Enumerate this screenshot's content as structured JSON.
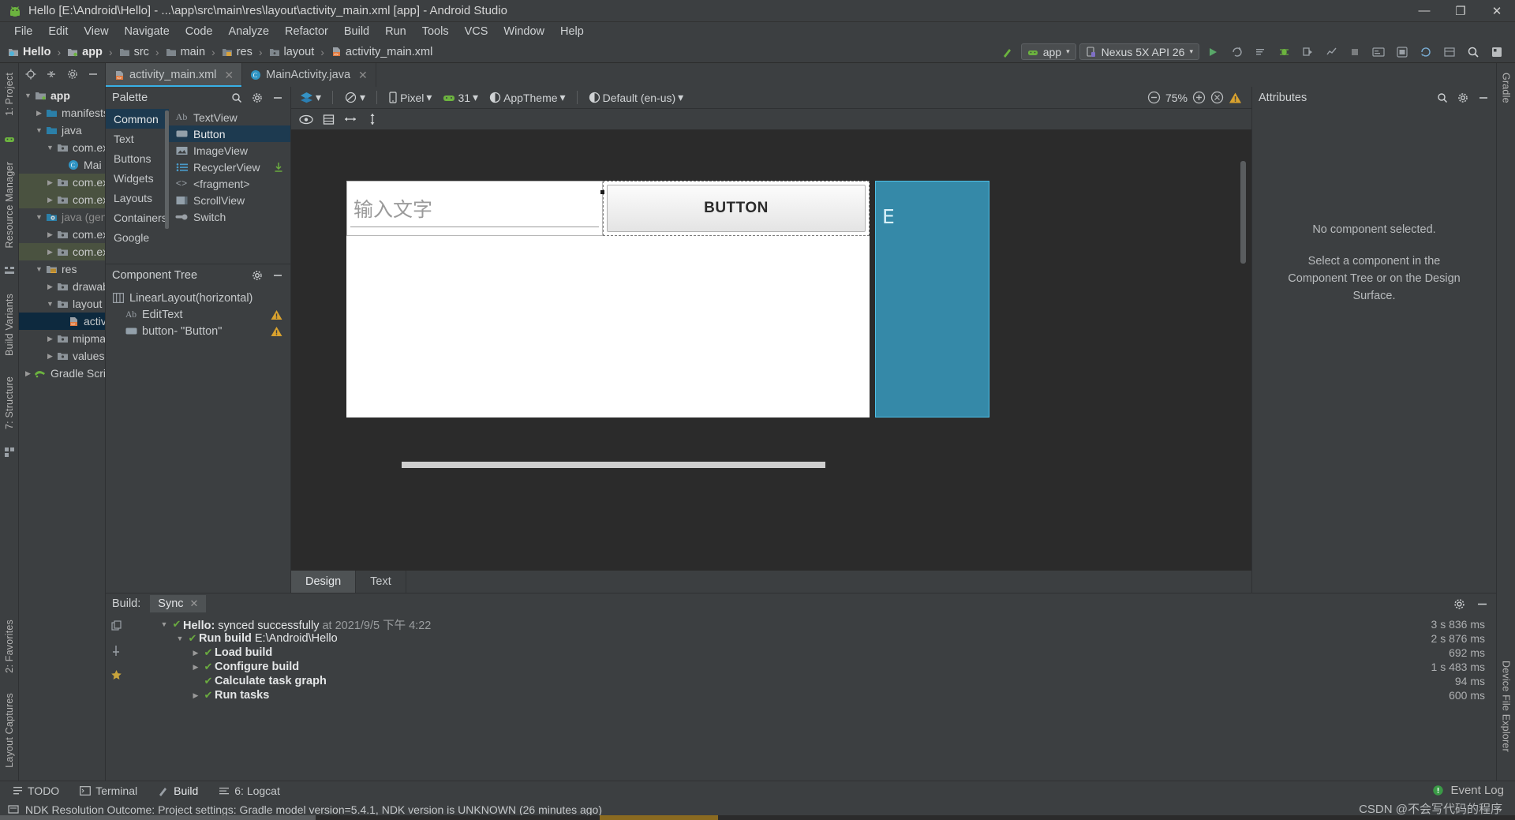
{
  "window": {
    "title": "Hello [E:\\Android\\Hello] - ...\\app\\src\\main\\res\\layout\\activity_main.xml [app] - Android Studio",
    "app_icon": "android-studio-icon",
    "minimize": "—",
    "maximize": "❐",
    "close": "✕"
  },
  "menubar": {
    "items": [
      "File",
      "Edit",
      "View",
      "Navigate",
      "Code",
      "Analyze",
      "Refactor",
      "Build",
      "Run",
      "Tools",
      "VCS",
      "Window",
      "Help"
    ]
  },
  "navbar": {
    "breadcrumbs": [
      {
        "label": "Hello",
        "icon": "module-icon",
        "bold": true
      },
      {
        "label": "app",
        "icon": "app-module-icon",
        "bold": true
      },
      {
        "label": "src",
        "icon": "folder-icon",
        "bold": false
      },
      {
        "label": "main",
        "icon": "folder-icon",
        "bold": false
      },
      {
        "label": "res",
        "icon": "res-folder-icon",
        "bold": false
      },
      {
        "label": "layout",
        "icon": "folder-icon",
        "bold": false
      },
      {
        "label": "activity_main.xml",
        "icon": "xml-layout-icon",
        "bold": false
      }
    ],
    "separator": "›",
    "run_config": {
      "label": "app",
      "icon": "android-head-icon",
      "caret": "▾"
    },
    "device": {
      "label": "Nexus 5X API 26",
      "icon": "device-icon",
      "caret": "▾"
    },
    "icons": [
      "build-hammer-icon",
      "run-icon",
      "apply-changes-icon",
      "apply-code-changes-icon",
      "debug-icon",
      "attach-debugger-icon",
      "profiler-icon",
      "stop-icon",
      "sdk-manager-icon",
      "avd-manager-icon",
      "sync-gradle-icon",
      "layout-inspector-icon",
      "search-icon",
      "settings-icon"
    ]
  },
  "left_rail": {
    "tabs": [
      "1: Project",
      "Resource Manager",
      "Build Variants",
      "7: Structure",
      "2: Favorites",
      "Layout Captures"
    ]
  },
  "right_rail": {
    "tabs": [
      "Gradle",
      "Device File Explorer"
    ]
  },
  "project": {
    "header_icons": [
      "locate-icon",
      "collapse-all-icon",
      "settings-icon",
      "hide-icon"
    ],
    "tree": [
      {
        "depth": 0,
        "twisty": "▼",
        "icon": "app-module-icon",
        "label": "app",
        "bold": true,
        "style": "normal"
      },
      {
        "depth": 1,
        "twisty": "▶",
        "icon": "folder-blue-icon",
        "label": "manifests",
        "bold": false,
        "style": "normal"
      },
      {
        "depth": 1,
        "twisty": "▼",
        "icon": "folder-blue-icon",
        "label": "java",
        "bold": false,
        "style": "normal"
      },
      {
        "depth": 2,
        "twisty": "▼",
        "icon": "package-icon",
        "label": "com.ex",
        "bold": false,
        "style": "normal"
      },
      {
        "depth": 3,
        "twisty": "",
        "icon": "class-icon",
        "label": "Mai",
        "bold": false,
        "style": "normal"
      },
      {
        "depth": 2,
        "twisty": "▶",
        "icon": "package-icon",
        "label": "com.ex",
        "bold": false,
        "style": "green"
      },
      {
        "depth": 2,
        "twisty": "▶",
        "icon": "package-icon",
        "label": "com.ex",
        "bold": false,
        "style": "green"
      },
      {
        "depth": 1,
        "twisty": "▼",
        "icon": "generated-folder-icon",
        "label": "java (gene",
        "bold": false,
        "style": "dim"
      },
      {
        "depth": 2,
        "twisty": "▶",
        "icon": "package-icon",
        "label": "com.ex",
        "bold": false,
        "style": "normal"
      },
      {
        "depth": 2,
        "twisty": "▶",
        "icon": "package-icon",
        "label": "com.ex",
        "bold": false,
        "style": "green"
      },
      {
        "depth": 1,
        "twisty": "▼",
        "icon": "res-folder-icon",
        "label": "res",
        "bold": false,
        "style": "normal"
      },
      {
        "depth": 2,
        "twisty": "▶",
        "icon": "package-icon",
        "label": "drawab",
        "bold": false,
        "style": "normal"
      },
      {
        "depth": 2,
        "twisty": "▼",
        "icon": "package-icon",
        "label": "layout",
        "bold": false,
        "style": "normal"
      },
      {
        "depth": 3,
        "twisty": "",
        "icon": "xml-layout-icon",
        "label": "activ",
        "bold": false,
        "style": "selected"
      },
      {
        "depth": 2,
        "twisty": "▶",
        "icon": "package-icon",
        "label": "mipmap",
        "bold": false,
        "style": "normal"
      },
      {
        "depth": 2,
        "twisty": "▶",
        "icon": "package-icon",
        "label": "values",
        "bold": false,
        "style": "normal"
      },
      {
        "depth": 0,
        "twisty": "▶",
        "icon": "gradle-icon",
        "label": "Gradle Scripts",
        "bold": false,
        "style": "normal"
      }
    ]
  },
  "editor_tabs": [
    {
      "label": "activity_main.xml",
      "icon": "xml-layout-icon",
      "active": true,
      "close": "✕"
    },
    {
      "label": "MainActivity.java",
      "icon": "class-icon",
      "active": false,
      "close": "✕"
    }
  ],
  "palette": {
    "title": "Palette",
    "header_icons": [
      "search-icon",
      "settings-icon",
      "hide-icon"
    ],
    "categories": [
      "Common",
      "Text",
      "Buttons",
      "Widgets",
      "Layouts",
      "Containers",
      "Google"
    ],
    "selected_category": "Common",
    "items": [
      {
        "label": "TextView",
        "icon": "textview-icon"
      },
      {
        "label": "Button",
        "icon": "button-icon"
      },
      {
        "label": "ImageView",
        "icon": "imageview-icon"
      },
      {
        "label": "RecyclerView",
        "icon": "recyclerview-icon"
      },
      {
        "label": "<fragment>",
        "icon": "fragment-icon"
      },
      {
        "label": "ScrollView",
        "icon": "scrollview-icon"
      },
      {
        "label": "Switch",
        "icon": "switch-icon"
      }
    ],
    "selected_item": "Button",
    "download_icon": "download-icon"
  },
  "component_tree": {
    "title": "Component Tree",
    "header_icons": [
      "settings-icon",
      "hide-icon"
    ],
    "nodes": [
      {
        "depth": 0,
        "icon": "linearlayout-icon",
        "label": "LinearLayout(horizontal)",
        "warning": false
      },
      {
        "depth": 1,
        "icon": "edittext-icon",
        "label": "EditText",
        "warning": true
      },
      {
        "depth": 1,
        "icon": "button-icon",
        "label": "button- \"Button\"",
        "warning": true
      }
    ],
    "warning_icon": "warning-triangle-icon"
  },
  "surface_toolbar": {
    "design_mode": {
      "label": "",
      "icon": "layers-icon",
      "caret": "▾"
    },
    "orientation": {
      "label": "",
      "icon": "rotate-icon",
      "caret": "▾"
    },
    "device": {
      "label": "Pixel",
      "icon": "phone-icon",
      "caret": "▾"
    },
    "api": {
      "label": "31",
      "icon": "android-head-icon",
      "caret": "▾"
    },
    "theme": {
      "label": "AppTheme",
      "icon": "theme-icon",
      "caret": "▾"
    },
    "locale": {
      "label": "Default (en-us)",
      "icon": "locale-icon",
      "caret": "▾"
    },
    "zoom_out_icon": "zoom-out-icon",
    "zoom_level": "75%",
    "zoom_in_icon": "zoom-in-icon",
    "zoom_fit_icon": "zoom-fit-icon",
    "warning_icon": "warning-triangle-icon"
  },
  "surface_subtoolbar": {
    "icons": [
      "eye-icon",
      "blueprint-icon",
      "match-width-icon",
      "match-height-icon"
    ]
  },
  "design_preview": {
    "edittext_hint": "输入文字",
    "button_label": "BUTTON",
    "right_panel_label": "E",
    "accent_blue": "#2e7a96"
  },
  "design_tabs": [
    {
      "label": "Design",
      "active": true
    },
    {
      "label": "Text",
      "active": false
    }
  ],
  "attributes": {
    "title": "Attributes",
    "header_icons": [
      "search-icon",
      "settings-icon",
      "hide-icon"
    ],
    "empty_title": "No component selected.",
    "empty_message": "Select a component in the Component Tree or on the Design Surface."
  },
  "build_panel": {
    "label": "Build:",
    "tab": "Sync",
    "tab_close": "✕",
    "header_icons": [
      "settings-icon",
      "hide-icon"
    ],
    "left_icons": [
      "restart-icon",
      "pin-icon",
      "star-icon"
    ],
    "rows": [
      {
        "depth": 0,
        "twisty": "▼",
        "check": "✔",
        "text": "Hello:",
        "sub": " synced successfully",
        "tail": " at 2021/9/5 下午 4:22",
        "bold": true,
        "time": "3 s 836 ms"
      },
      {
        "depth": 1,
        "twisty": "▼",
        "check": "✔",
        "text": "Run build",
        "sub": " E:\\Android\\Hello",
        "tail": "",
        "bold": true,
        "time": "2 s 876 ms"
      },
      {
        "depth": 2,
        "twisty": "▶",
        "check": "✔",
        "text": "Load build",
        "sub": "",
        "tail": "",
        "bold": false,
        "time": "692 ms"
      },
      {
        "depth": 2,
        "twisty": "▶",
        "check": "✔",
        "text": "Configure build",
        "sub": "",
        "tail": "",
        "bold": false,
        "time": "1 s 483 ms"
      },
      {
        "depth": 2,
        "twisty": "",
        "check": "✔",
        "text": "Calculate task graph",
        "sub": "",
        "tail": "",
        "bold": false,
        "time": "94 ms"
      },
      {
        "depth": 2,
        "twisty": "▶",
        "check": "✔",
        "text": "Run tasks",
        "sub": "",
        "tail": "",
        "bold": false,
        "time": "600 ms"
      }
    ]
  },
  "status_tabs": [
    {
      "label": "TODO",
      "icon": "todo-icon",
      "active": false
    },
    {
      "label": "Terminal",
      "icon": "terminal-icon",
      "active": false
    },
    {
      "label": "Build",
      "icon": "build-hammer-icon",
      "active": true
    },
    {
      "label": "6: Logcat",
      "icon": "logcat-icon",
      "active": false
    }
  ],
  "status_right": {
    "label": "Event Log",
    "icon": "event-log-icon"
  },
  "status_line": {
    "icon": "info-icon",
    "message": "NDK Resolution Outcome: Project settings: Gradle model version=5.4.1, NDK version is UNKNOWN (26 minutes ago)",
    "watermark": "CSDN @不会写代码的程序"
  }
}
